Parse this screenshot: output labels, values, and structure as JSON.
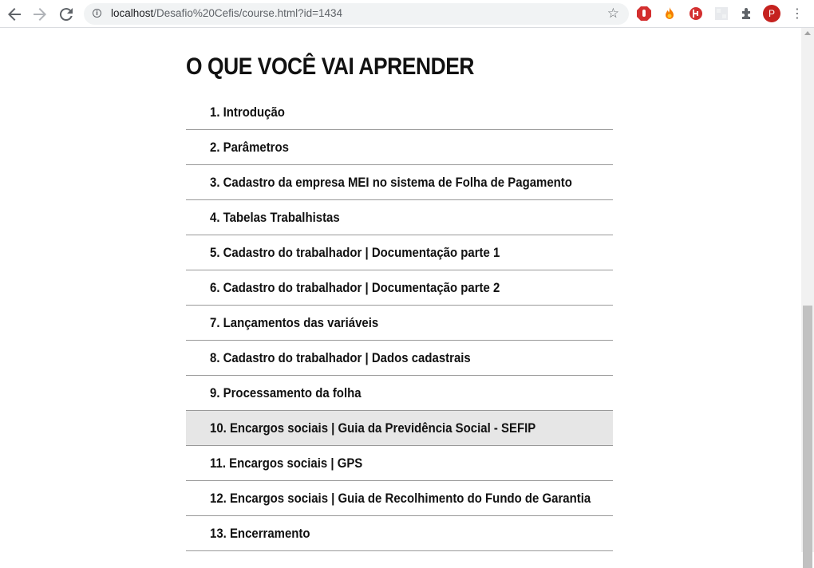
{
  "browser": {
    "url_host": "localhost",
    "url_path": "/Desafio%20Cefis/course.html?id=1434",
    "profile_initial": "P",
    "icons": [
      "back-icon",
      "forward-icon",
      "reload-icon",
      "info-icon",
      "star-icon",
      "adblock-icon",
      "fire-icon",
      "extension-red-icon",
      "extension-grid-icon",
      "puzzle-icon",
      "menu-icon"
    ]
  },
  "section": {
    "title": "O QUE VOCÊ VAI APRENDER"
  },
  "lessons": [
    {
      "label": "1. Introdução"
    },
    {
      "label": "2. Parâmetros"
    },
    {
      "label": "3. Cadastro da empresa MEI no sistema de Folha de Pagamento"
    },
    {
      "label": "4. Tabelas Trabalhistas"
    },
    {
      "label": "5. Cadastro do trabalhador | Documentação parte 1"
    },
    {
      "label": "6. Cadastro do trabalhador | Documentação parte 2"
    },
    {
      "label": "7. Lançamentos das variáveis"
    },
    {
      "label": "8. Cadastro do trabalhador | Dados cadastrais"
    },
    {
      "label": "9. Processamento da folha"
    },
    {
      "label": "10. Encargos sociais | Guia da Previdência Social - SEFIP",
      "highlighted": true
    },
    {
      "label": "11. Encargos sociais | GPS"
    },
    {
      "label": "12. Encargos sociais | Guia de Recolhimento do Fundo de Garantia"
    },
    {
      "label": "13. Encerramento"
    }
  ],
  "colors": {
    "highlight_row": "#e6e6e6",
    "profile": "#c5221f"
  }
}
